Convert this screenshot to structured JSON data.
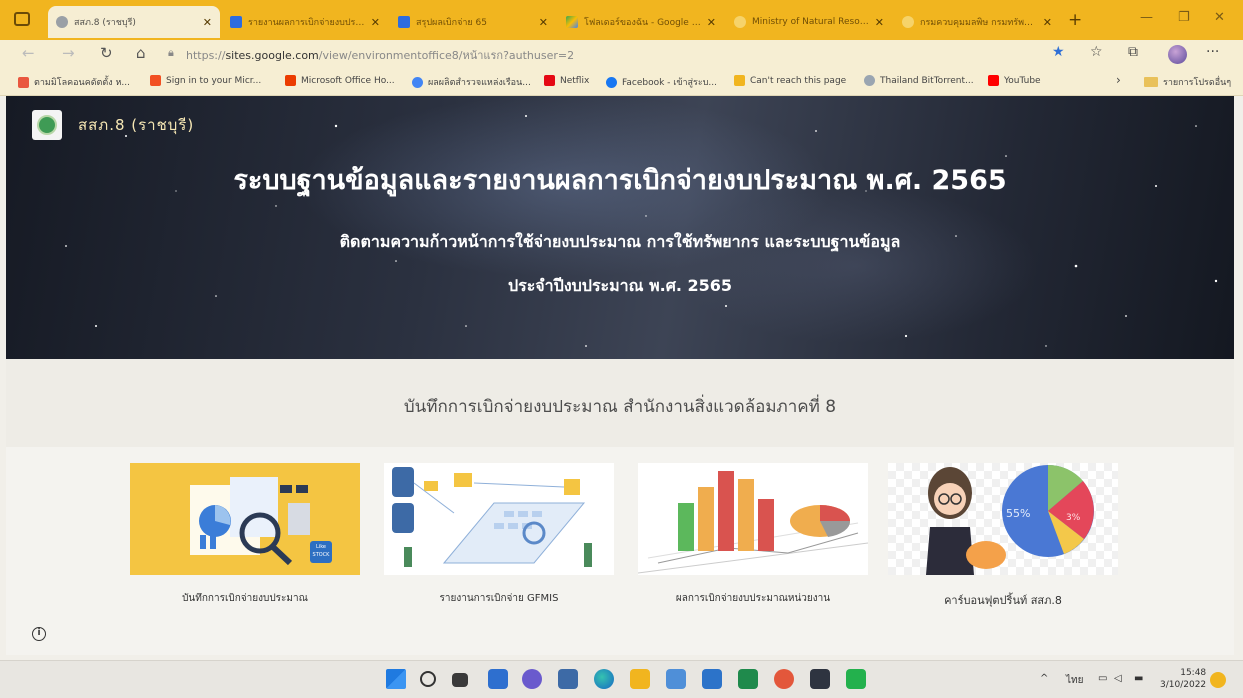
{
  "browser": {
    "tabs": [
      {
        "title": "สสภ.8 (ราชบุรี)",
        "active": true,
        "favicon": "google-sites-icon"
      },
      {
        "title": "รายงานผลการเบิกจ่ายงบประมาณ",
        "active": false,
        "favicon": "sheets-icon"
      },
      {
        "title": "สรุปผลเบิกจ่าย 65",
        "active": false,
        "favicon": "sheets-icon"
      },
      {
        "title": "โฟลเดอร์ของฉัน - Google ไดรฟ์",
        "active": false,
        "favicon": "drive-icon"
      },
      {
        "title": "Ministry of Natural Resources",
        "active": false,
        "favicon": "ministry-icon"
      },
      {
        "title": "กรมควบคุมมลพิษ กรมทรัพยากร",
        "active": false,
        "favicon": "ministry-icon"
      }
    ],
    "url_prefix": "https://",
    "url_host": "sites.google.com",
    "url_path": "/view/environmentoffice8/หน้าแรก?authuser=2",
    "bookmarks": [
      {
        "label": "ตามมิโลคอนคดัตตั้ง ห...",
        "icon_color": "#e9573f"
      },
      {
        "label": "Sign in to your Micr...",
        "icon_color": "#f25022"
      },
      {
        "label": "Microsoft Office Ho...",
        "icon_color": "#eb3c00"
      },
      {
        "label": "ผลผลิตสำรวจแหล่งเรือน...",
        "icon_color": "#4285f4"
      },
      {
        "label": "Netflix",
        "icon_color": "#e50914"
      },
      {
        "label": "Facebook - เข้าสู่ระบ...",
        "icon_color": "#1877f2"
      },
      {
        "label": "Can't reach this page",
        "icon_color": "#f1b51f"
      },
      {
        "label": "Thailand BitTorrent...",
        "icon_color": "#9aa5b1"
      },
      {
        "label": "YouTube",
        "icon_color": "#ff0000"
      }
    ],
    "bookmarks_folder": "รายการโปรดอื่นๆ"
  },
  "site": {
    "name": "สสภ.8 (ราชบุรี)",
    "hero_title": "ระบบฐานข้อมูลและรายงานผลการเบิกจ่ายงบประมาณ พ.ศ. 2565",
    "hero_subtitle_1": "ติดตามความก้าวหน้าการใช้จ่ายงบประมาณ การใช้ทรัพยากร และระบบฐานข้อมูล",
    "hero_subtitle_2": "ประจำปีงบประมาณ พ.ศ. 2565",
    "section_heading": "บันทึกการเบิกจ่ายงบประมาณ สำนักงานสิ่งแวดล้อมภาคที่ 8",
    "cards": [
      {
        "caption": "บันทึกการเบิกจ่ายงบประมาณ",
        "image": "finance-documents-illustration"
      },
      {
        "caption": "รายงานการเบิกจ่าย GFMIS",
        "image": "data-network-illustration"
      },
      {
        "caption": "ผลการเบิกจ่ายงบประมาณหน่วยงาน",
        "image": "bar-chart-illustration"
      },
      {
        "caption": "คาร์บอนฟุตปริ้นท์ สสภ.8",
        "image": "pie-chart-person-illustration"
      }
    ],
    "pie_label_1": "55%",
    "pie_label_2": "3%",
    "badge_text": "Like STOCK"
  },
  "taskbar": {
    "lang": "ไทย",
    "time": "15:48",
    "date": "3/10/2022"
  },
  "colors": {
    "accent": "#f1b51f",
    "toolbar": "#f6eed3",
    "hero_dark": "#1b1f2a"
  }
}
